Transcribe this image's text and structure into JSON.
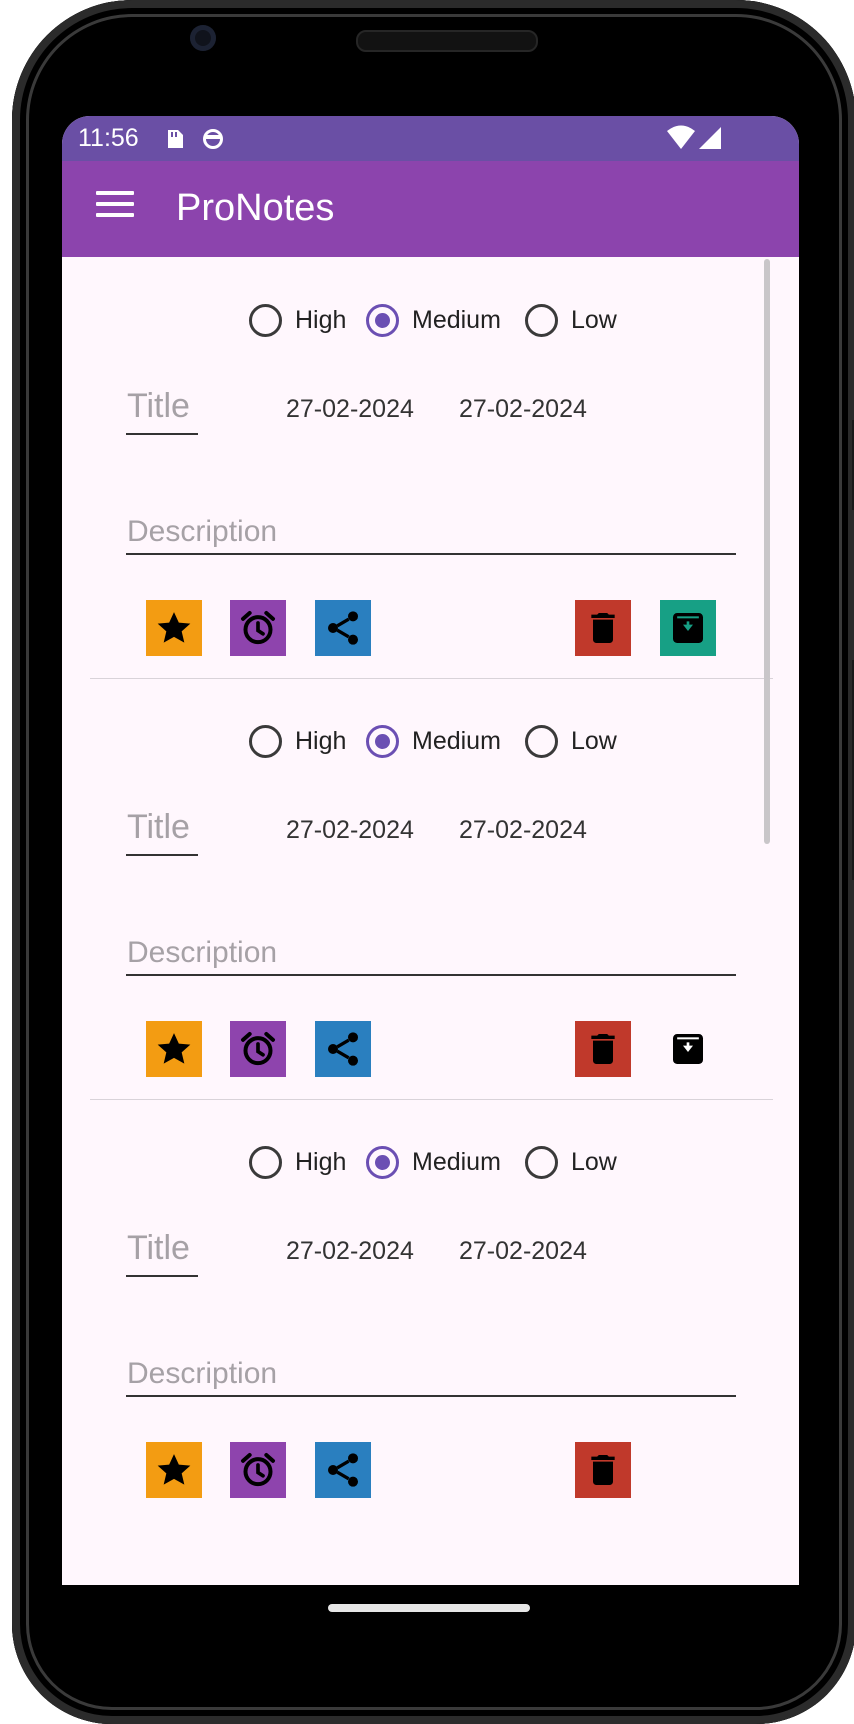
{
  "status_bar": {
    "time": "11:56",
    "icons": [
      "sd-card-icon",
      "notification-icon",
      "wifi-icon",
      "cell-signal-icon"
    ]
  },
  "app_bar": {
    "title": "ProNotes",
    "menu_icon": "hamburger-menu-icon"
  },
  "colors": {
    "status_bar": "#6a4fa5",
    "app_bar": "#8c44ad",
    "background": "#fff7fd",
    "radio_accent": "#6b4fb3",
    "favorite": "#f39c12",
    "reminder": "#8e44ad",
    "share": "#2a7fbf",
    "delete": "#c0392b",
    "archive": "#17a085"
  },
  "notes": [
    {
      "priority": {
        "options": [
          "High",
          "Medium",
          "Low"
        ],
        "selected": "Medium"
      },
      "title_placeholder": "Title",
      "date_created": "27-02-2024",
      "date_modified": "27-02-2024",
      "description_placeholder": "Description",
      "actions": [
        "star-icon",
        "alarm-icon",
        "share-icon",
        "delete-icon",
        "archive-icon"
      ],
      "archive_style": "teal"
    },
    {
      "priority": {
        "options": [
          "High",
          "Medium",
          "Low"
        ],
        "selected": "Medium"
      },
      "title_placeholder": "Title",
      "date_created": "27-02-2024",
      "date_modified": "27-02-2024",
      "description_placeholder": "Description",
      "actions": [
        "star-icon",
        "alarm-icon",
        "share-icon",
        "delete-icon",
        "archive-icon"
      ],
      "archive_style": "plain"
    },
    {
      "priority": {
        "options": [
          "High",
          "Medium",
          "Low"
        ],
        "selected": "Medium"
      },
      "title_placeholder": "Title",
      "date_created": "27-02-2024",
      "date_modified": "27-02-2024",
      "description_placeholder": "Description",
      "actions": [
        "star-icon",
        "alarm-icon",
        "share-icon",
        "delete-icon",
        "archive-icon"
      ],
      "archive_style": "hidden"
    }
  ]
}
